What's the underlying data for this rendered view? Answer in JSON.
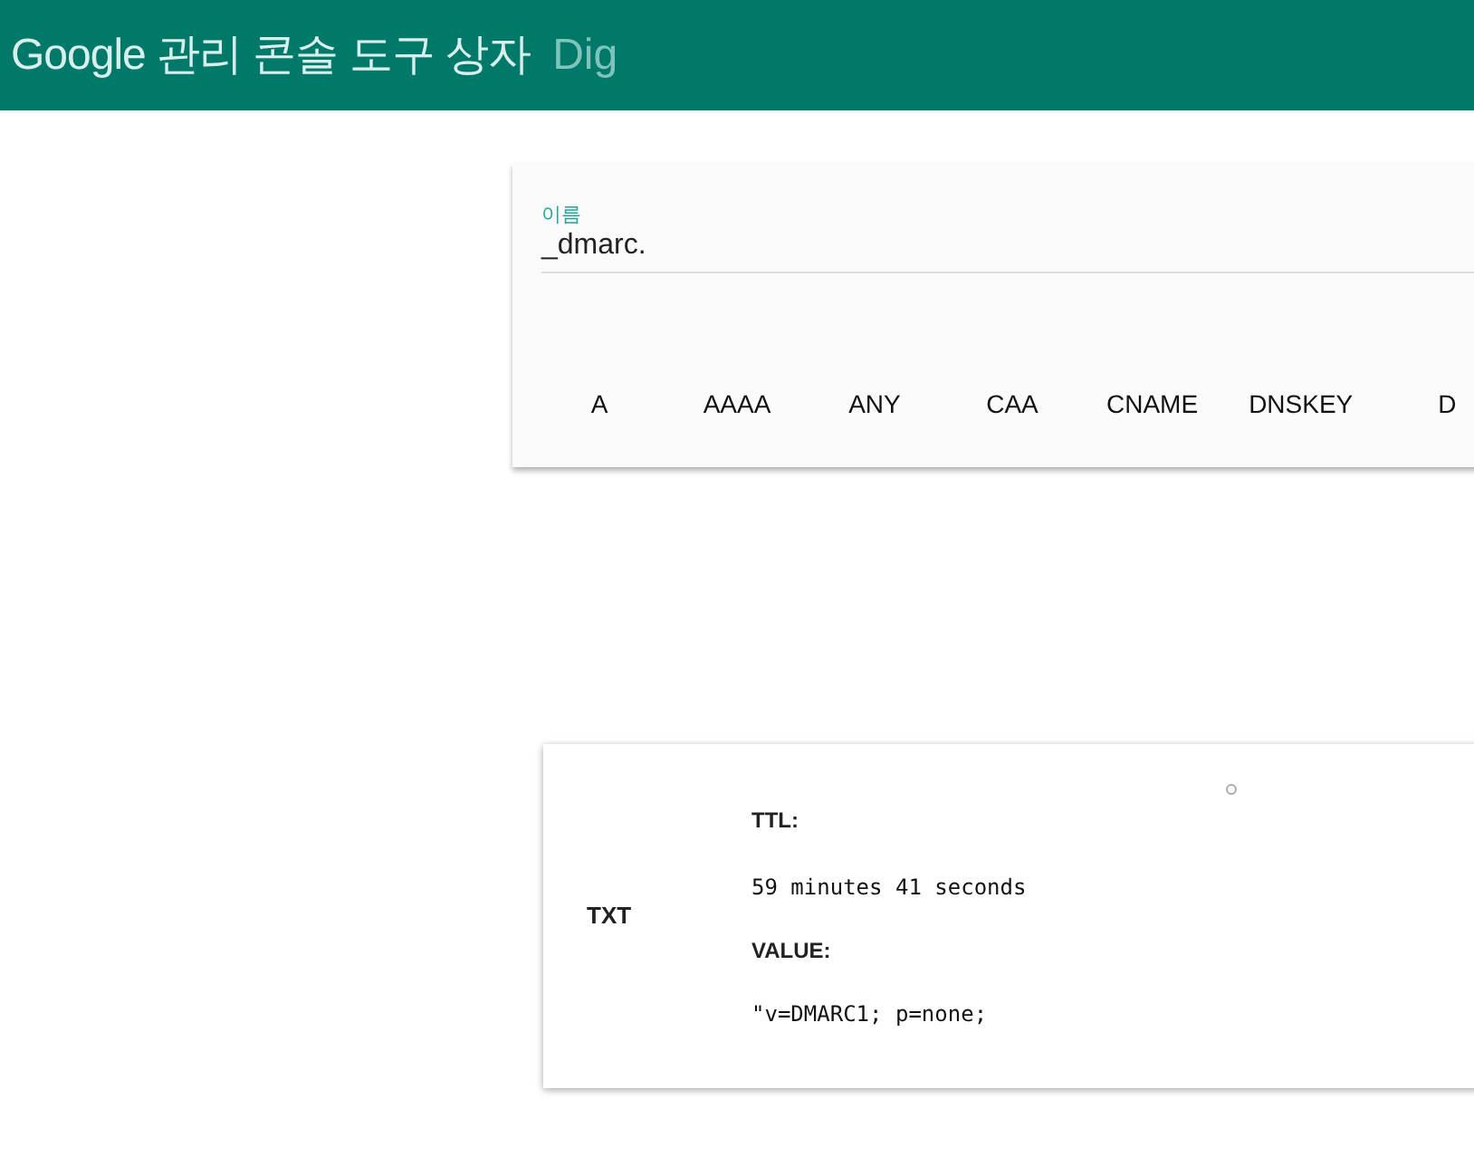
{
  "header": {
    "title": "Google 관리 콘솔 도구 상자",
    "subtitle": "Dig"
  },
  "name_field": {
    "label": "이름",
    "value": "_dmarc."
  },
  "record_types": [
    "A",
    "AAAA",
    "ANY",
    "CAA",
    "CNAME",
    "DNSKEY",
    "D"
  ],
  "result": {
    "type": "TXT",
    "ttl_label": "TTL:",
    "ttl": "59 minutes 41 seconds",
    "value_label": "VALUE:",
    "value": "\"v=DMARC1; p=none;"
  }
}
